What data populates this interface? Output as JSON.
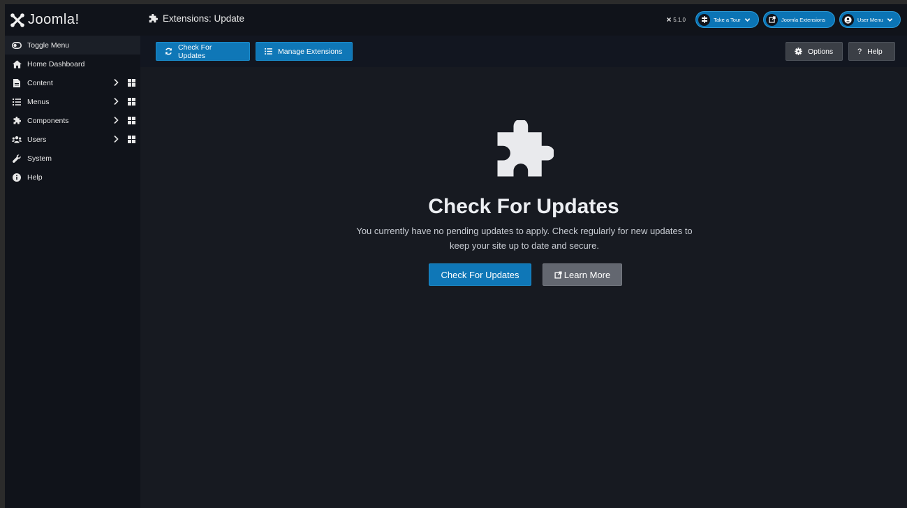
{
  "header": {
    "logo_text": "Joomla!",
    "page_title": "Extensions: Update",
    "version": "5.1.0",
    "take_tour": "Take a Tour",
    "joomla_extensions": "Joomla Extensions",
    "user_menu": "User Menu"
  },
  "sidebar": {
    "items": [
      {
        "label": "Toggle Menu",
        "icon": "toggle-icon"
      },
      {
        "label": "Home Dashboard",
        "icon": "home-icon"
      },
      {
        "label": "Content",
        "icon": "file-icon"
      },
      {
        "label": "Menus",
        "icon": "list-icon"
      },
      {
        "label": "Components",
        "icon": "puzzle-icon"
      },
      {
        "label": "Users",
        "icon": "users-icon"
      },
      {
        "label": "System",
        "icon": "wrench-icon"
      },
      {
        "label": "Help",
        "icon": "info-icon"
      }
    ]
  },
  "toolbar": {
    "check_updates": "Check For Updates",
    "manage_extensions": "Manage Extensions",
    "options": "Options",
    "help": "Help"
  },
  "main": {
    "title": "Check For Updates",
    "description": "You currently have no pending updates to apply. Check regularly for new updates to keep your site up to date and secure.",
    "primary_button": "Check For Updates",
    "secondary_button": "Learn More"
  },
  "colors": {
    "primary": "#0f77b7",
    "background": "#171a21",
    "sidebar": "#10131a"
  }
}
